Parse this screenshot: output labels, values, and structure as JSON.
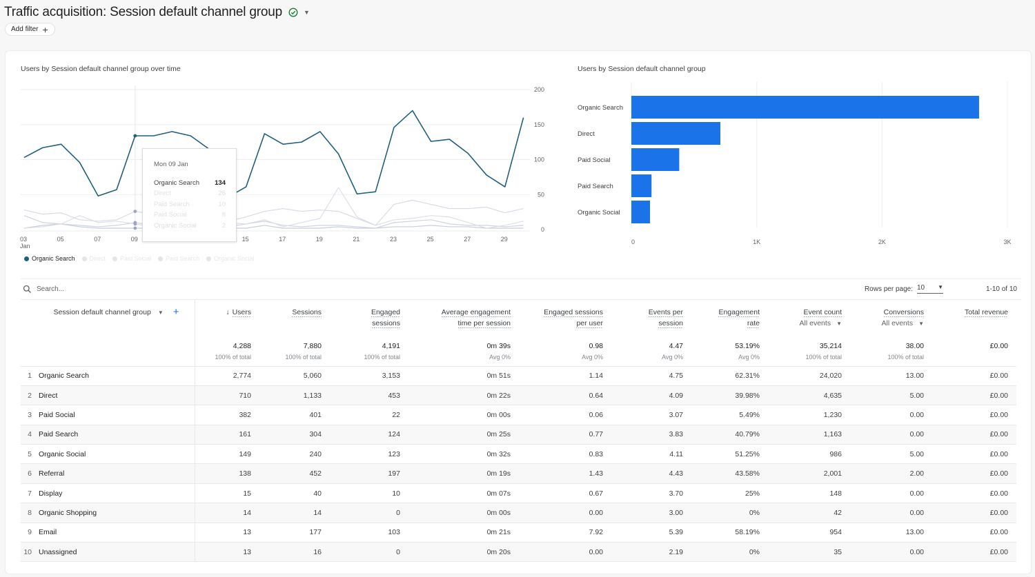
{
  "header": {
    "title": "Traffic acquisition: Session default channel group",
    "status_icon": "check-circle-icon",
    "add_filter_label": "Add filter"
  },
  "line_chart_title": "Users by Session default channel group over time",
  "bar_chart_title": "Users by Session default channel group",
  "tooltip": {
    "date": "Mon 09 Jan",
    "rows": [
      {
        "label": "Organic Search",
        "value": "134",
        "active": true
      },
      {
        "label": "Direct",
        "value": "26",
        "active": false
      },
      {
        "label": "Paid Search",
        "value": "10",
        "active": false
      },
      {
        "label": "Paid Social",
        "value": "8",
        "active": false
      },
      {
        "label": "Organic Social",
        "value": "2",
        "active": false
      }
    ]
  },
  "legend": [
    {
      "label": "Organic Search",
      "active": true
    },
    {
      "label": "Direct",
      "active": false
    },
    {
      "label": "Paid Social",
      "active": false
    },
    {
      "label": "Paid Search",
      "active": false
    },
    {
      "label": "Organic Social",
      "active": false
    }
  ],
  "colors": {
    "organic_search_line": "#1f5f7f",
    "dim_line": "#d9dce6",
    "bar": "#1a73e8",
    "accent": "#1a73e8"
  },
  "chart_data": [
    {
      "type": "line",
      "title": "Users by Session default channel group over time",
      "x": [
        "03",
        "04",
        "05",
        "06",
        "07",
        "08",
        "09",
        "10",
        "11",
        "12",
        "13",
        "14",
        "15",
        "16",
        "17",
        "18",
        "19",
        "20",
        "21",
        "22",
        "23",
        "24",
        "25",
        "26",
        "27",
        "28",
        "29",
        "30"
      ],
      "x_ticks": [
        "03\nJan",
        "05",
        "07",
        "09",
        "11",
        "13",
        "15",
        "17",
        "19",
        "21",
        "23",
        "25",
        "27",
        "29"
      ],
      "x_tick_labels": [
        "03",
        "05",
        "07",
        "09",
        "11",
        "13",
        "15",
        "17",
        "19",
        "21",
        "23",
        "25",
        "27",
        "29"
      ],
      "x_first_sublabel": "Jan",
      "y_ticks": [
        0,
        50,
        100,
        150,
        200
      ],
      "ylim": [
        0,
        200
      ],
      "y_axis_side": "right",
      "grid": true,
      "legend_position": "bottom-left",
      "highlight_x": "09",
      "series": [
        {
          "name": "Organic Search",
          "values": [
            103,
            117,
            122,
            96,
            48,
            57,
            134,
            134,
            140,
            134,
            115,
            46,
            61,
            137,
            122,
            125,
            140,
            108,
            51,
            54,
            146,
            170,
            126,
            129,
            109,
            78,
            61,
            160
          ]
        },
        {
          "name": "Direct",
          "values": [
            28,
            22,
            24,
            14,
            12,
            14,
            26,
            22,
            20,
            18,
            16,
            12,
            18,
            26,
            30,
            26,
            28,
            26,
            16,
            6,
            36,
            42,
            36,
            30,
            30,
            32,
            24,
            30
          ]
        },
        {
          "name": "Paid Social",
          "values": [
            2,
            4,
            8,
            20,
            10,
            12,
            8,
            4,
            2,
            4,
            8,
            10,
            8,
            14,
            4,
            10,
            16,
            60,
            18,
            6,
            14,
            16,
            20,
            18,
            10,
            2,
            6,
            12
          ]
        },
        {
          "name": "Paid Search",
          "values": [
            20,
            10,
            8,
            6,
            4,
            6,
            10,
            6,
            4,
            6,
            4,
            4,
            8,
            12,
            6,
            4,
            6,
            6,
            4,
            2,
            10,
            12,
            14,
            8,
            6,
            6,
            4,
            6
          ]
        },
        {
          "name": "Organic Social",
          "values": [
            2,
            6,
            8,
            4,
            2,
            2,
            2,
            2,
            2,
            2,
            2,
            2,
            2,
            6,
            2,
            2,
            2,
            4,
            2,
            2,
            4,
            4,
            6,
            4,
            4,
            2,
            2,
            2
          ]
        }
      ]
    },
    {
      "type": "bar",
      "orientation": "horizontal",
      "title": "Users by Session default channel group",
      "categories": [
        "Organic Search",
        "Direct",
        "Paid Social",
        "Paid Search",
        "Organic Social"
      ],
      "values": [
        2774,
        710,
        382,
        161,
        149
      ],
      "x_ticks": [
        0,
        1000,
        2000,
        3000
      ],
      "x_tick_labels": [
        "0",
        "1K",
        "2K",
        "3K"
      ],
      "xlim": [
        0,
        3000
      ],
      "grid": true
    }
  ],
  "table": {
    "search_placeholder": "Search...",
    "rows_per_page_label": "Rows per page:",
    "rows_per_page_value": "10",
    "pagination": "1-10 of 10",
    "dimension_header": "Session default channel group",
    "columns": [
      {
        "line1": "Users",
        "line2": "",
        "sorted": true,
        "sub": ""
      },
      {
        "line1": "Sessions",
        "line2": "",
        "sub": ""
      },
      {
        "line1": "Engaged",
        "line2": "sessions",
        "sub": ""
      },
      {
        "line1": "Average engagement",
        "line2": "time per session",
        "sub": ""
      },
      {
        "line1": "Engaged sessions",
        "line2": "per user",
        "sub": ""
      },
      {
        "line1": "Events per",
        "line2": "session",
        "sub": ""
      },
      {
        "line1": "Engagement",
        "line2": "rate",
        "sub": ""
      },
      {
        "line1": "Event count",
        "line2": "",
        "sub": "All events"
      },
      {
        "line1": "Conversions",
        "line2": "",
        "sub": "All events"
      },
      {
        "line1": "Total revenue",
        "line2": "",
        "sub": ""
      }
    ],
    "totals": [
      {
        "value": "4,288",
        "sub": "100% of total"
      },
      {
        "value": "7,880",
        "sub": "100% of total"
      },
      {
        "value": "4,191",
        "sub": "100% of total"
      },
      {
        "value": "0m 39s",
        "sub": "Avg 0%"
      },
      {
        "value": "0.98",
        "sub": "Avg 0%"
      },
      {
        "value": "4.47",
        "sub": "Avg 0%"
      },
      {
        "value": "53.19%",
        "sub": "Avg 0%"
      },
      {
        "value": "35,214",
        "sub": "100% of total"
      },
      {
        "value": "38.00",
        "sub": "100% of total"
      },
      {
        "value": "£0.00",
        "sub": ""
      }
    ],
    "rows": [
      {
        "idx": "1",
        "name": "Organic Search",
        "cells": [
          "2,774",
          "5,060",
          "3,153",
          "0m 51s",
          "1.14",
          "4.75",
          "62.31%",
          "24,020",
          "13.00",
          "£0.00"
        ]
      },
      {
        "idx": "2",
        "name": "Direct",
        "cells": [
          "710",
          "1,133",
          "453",
          "0m 22s",
          "0.64",
          "4.09",
          "39.98%",
          "4,635",
          "5.00",
          "£0.00"
        ]
      },
      {
        "idx": "3",
        "name": "Paid Social",
        "cells": [
          "382",
          "401",
          "22",
          "0m 00s",
          "0.06",
          "3.07",
          "5.49%",
          "1,230",
          "0.00",
          "£0.00"
        ]
      },
      {
        "idx": "4",
        "name": "Paid Search",
        "cells": [
          "161",
          "304",
          "124",
          "0m 25s",
          "0.77",
          "3.83",
          "40.79%",
          "1,163",
          "0.00",
          "£0.00"
        ]
      },
      {
        "idx": "5",
        "name": "Organic Social",
        "cells": [
          "149",
          "240",
          "123",
          "0m 32s",
          "0.83",
          "4.11",
          "51.25%",
          "986",
          "5.00",
          "£0.00"
        ]
      },
      {
        "idx": "6",
        "name": "Referral",
        "cells": [
          "138",
          "452",
          "197",
          "0m 19s",
          "1.43",
          "4.43",
          "43.58%",
          "2,001",
          "2.00",
          "£0.00"
        ]
      },
      {
        "idx": "7",
        "name": "Display",
        "cells": [
          "15",
          "40",
          "10",
          "0m 07s",
          "0.67",
          "3.70",
          "25%",
          "148",
          "0.00",
          "£0.00"
        ]
      },
      {
        "idx": "8",
        "name": "Organic Shopping",
        "cells": [
          "14",
          "14",
          "0",
          "0m 00s",
          "0.00",
          "3.00",
          "0%",
          "42",
          "0.00",
          "£0.00"
        ]
      },
      {
        "idx": "9",
        "name": "Email",
        "cells": [
          "13",
          "177",
          "103",
          "0m 21s",
          "7.92",
          "5.39",
          "58.19%",
          "954",
          "13.00",
          "£0.00"
        ]
      },
      {
        "idx": "10",
        "name": "Unassigned",
        "cells": [
          "13",
          "16",
          "0",
          "0m 20s",
          "0.00",
          "2.19",
          "0%",
          "35",
          "0.00",
          "£0.00"
        ]
      }
    ]
  }
}
